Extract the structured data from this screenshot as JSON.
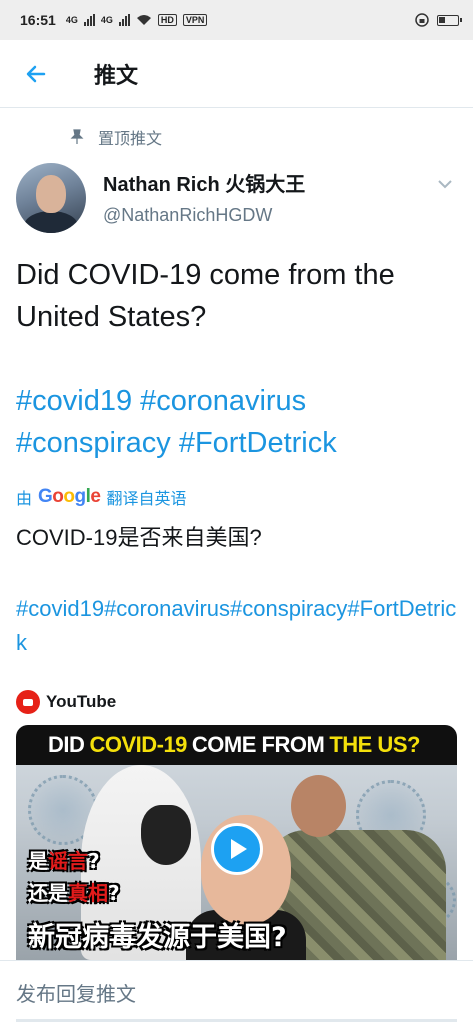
{
  "status_bar": {
    "time": "16:51",
    "net1": "4G",
    "net2": "4G",
    "hd": "HD",
    "vpn": "VPN"
  },
  "header": {
    "title": "推文"
  },
  "pinned": {
    "label": "置顶推文"
  },
  "user": {
    "name": "Nathan Rich 火锅大王",
    "handle": "@NathanRichHGDW"
  },
  "tweet": {
    "text": "Did COVID-19 come from the United States?",
    "hashtags": [
      "#covid19",
      "#coronavirus",
      "#conspiracy",
      "#FortDetrick"
    ]
  },
  "translation": {
    "prefix": "由",
    "provider": "Google",
    "suffix": "翻译自英语",
    "text": "COVID-19是否来自美国?",
    "hashtags": "#covid19#coronavirus#conspiracy#FortDetrick"
  },
  "card": {
    "source": "YouTube",
    "thumb_title_a": "DID",
    "thumb_title_b": "COVID-19",
    "thumb_title_c": "COME FROM",
    "thumb_title_d": "THE US?",
    "cn_line1_a": "是",
    "cn_line1_b": "谣言",
    "cn_line1_c": "?",
    "cn_line2_a": "还是",
    "cn_line2_b": "真相",
    "cn_line2_c": "?",
    "cn_line3": "新冠病毒发源于美国?"
  },
  "reply": {
    "placeholder": "发布回复推文"
  },
  "colors": {
    "accent": "#1da1f2",
    "link": "#1b95e0",
    "youtube_red": "#e62117"
  }
}
